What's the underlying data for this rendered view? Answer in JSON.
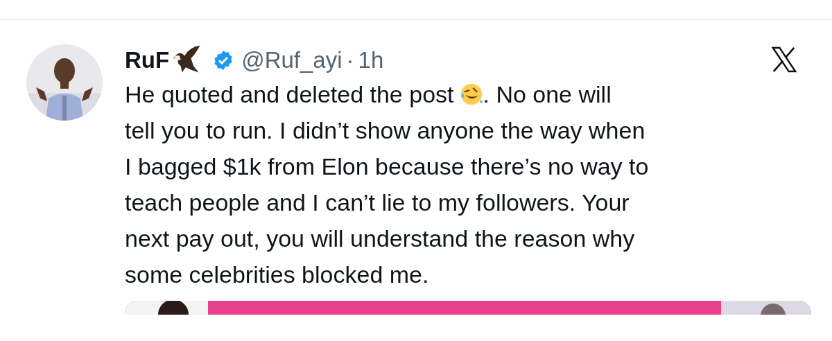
{
  "tweet": {
    "author": {
      "name": "RuF",
      "verified": true,
      "handle": "@Ruf_ayi",
      "separator": "·",
      "time": "1h"
    },
    "body": [
      [
        "He quoted and deleted the post",
        ". No one will"
      ],
      [
        "tell you to run. I didn’t show anyone the way when"
      ],
      [
        "I bagged $1k from Elon because there’s no way to"
      ],
      [
        "teach people and I can’t lie to my followers. Your"
      ],
      [
        "next pay out, you will understand the reason why"
      ],
      [
        "some celebrities blocked me."
      ]
    ],
    "media": {
      "kind": "picture"
    }
  }
}
